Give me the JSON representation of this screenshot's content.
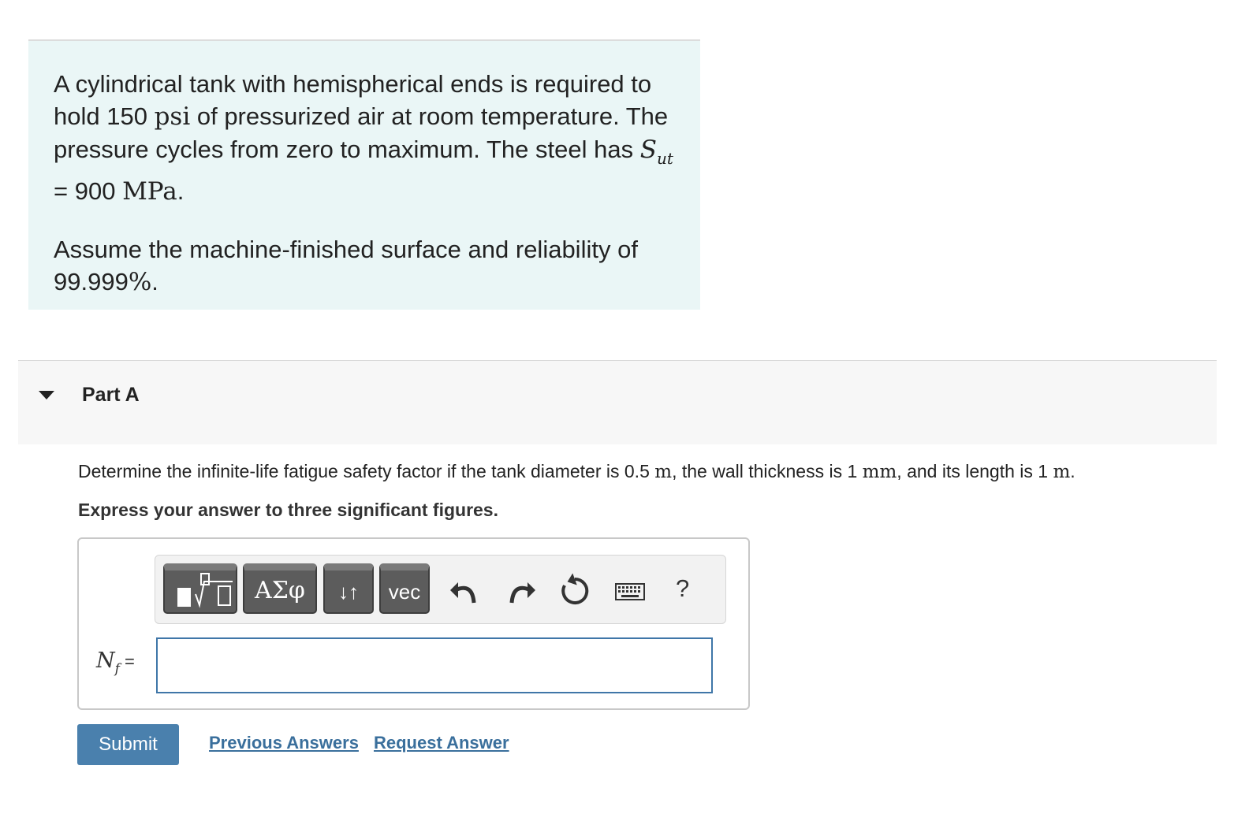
{
  "problem": {
    "line1_a": "A cylindrical tank with hemispherical ends is required to hold 150 ",
    "line1_unit": "psi",
    "line1_b": " of pressurized air at room temperature. The pressure cycles from zero to maximum. The steel has ",
    "sut_symbol": "S",
    "sut_subscript": "ut",
    "sut_value": " = 900 ",
    "sut_unit": "MPa",
    "sut_end": ".",
    "para2_a": "Assume the machine-finished surface and reliability of 99.999",
    "para2_unit": "%",
    "para2_end": "."
  },
  "part": {
    "title": "Part A"
  },
  "question": {
    "text_a": "Determine the infinite-life fatigue safety factor if the tank diameter is 0.5 ",
    "unit_a": "m",
    "text_b": ", the wall thickness is 1 ",
    "unit_b": "mm",
    "text_c": ", and its length is 1 ",
    "unit_c": "m",
    "text_d": ".",
    "instruction": "Express your answer to three significant figures."
  },
  "toolbar": {
    "greek_label": "ΑΣφ",
    "arrows_label": "↓↑",
    "vec_label": "vec",
    "help_label": "?"
  },
  "answer": {
    "var_symbol": "N",
    "var_subscript": "f",
    "equals": " =",
    "input_value": ""
  },
  "actions": {
    "submit_label": "Submit",
    "previous_label": "Previous Answers",
    "request_label": "Request Answer"
  }
}
